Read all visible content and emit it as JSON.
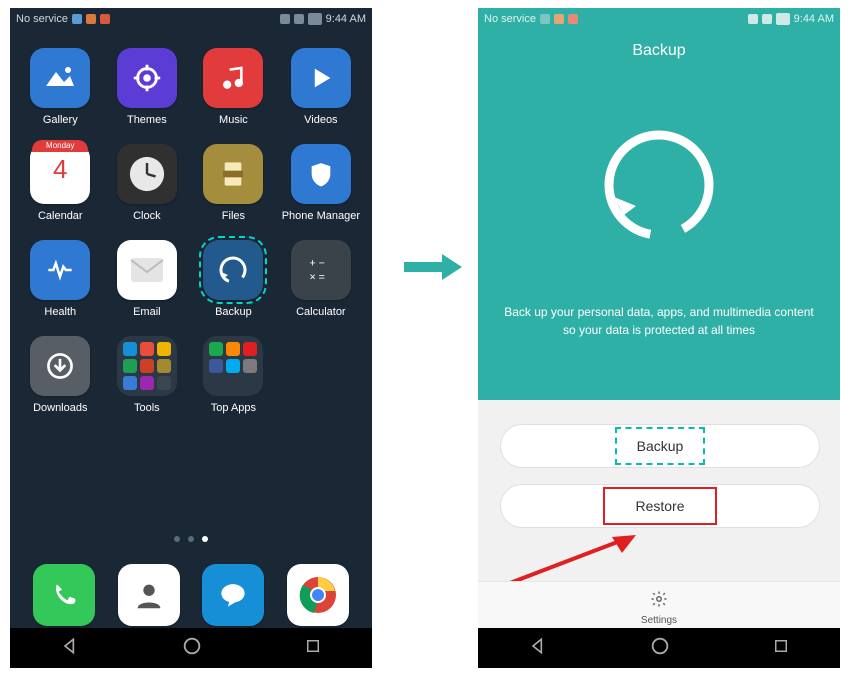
{
  "statusbar": {
    "network": "No service",
    "time": "9:44 AM"
  },
  "home": {
    "apps": [
      {
        "name": "gallery",
        "label": "Gallery",
        "bg": "#2f79d2",
        "glyph": "gallery"
      },
      {
        "name": "themes",
        "label": "Themes",
        "bg": "#5b3dd6",
        "glyph": "themes"
      },
      {
        "name": "music",
        "label": "Music",
        "bg": "#e23b3b",
        "glyph": "music"
      },
      {
        "name": "videos",
        "label": "Videos",
        "bg": "#2f79d2",
        "glyph": "play"
      },
      {
        "name": "calendar",
        "label": "Calendar",
        "bg": "#ffffff",
        "glyph": "calendar",
        "textcolor": "#e23b3b"
      },
      {
        "name": "clock",
        "label": "Clock",
        "bg": "#303030",
        "glyph": "clock"
      },
      {
        "name": "files",
        "label": "Files",
        "bg": "#a58d3e",
        "glyph": "files"
      },
      {
        "name": "phonemgr",
        "label": "Phone Manager",
        "bg": "#2f79d2",
        "glyph": "shield"
      },
      {
        "name": "health",
        "label": "Health",
        "bg": "#2f79d2",
        "glyph": "heart"
      },
      {
        "name": "email",
        "label": "Email",
        "bg": "#ffffff",
        "glyph": "mail",
        "textcolor": "#888"
      },
      {
        "name": "backup",
        "label": "Backup",
        "bg": "#235a8e",
        "glyph": "backup",
        "highlight": true
      },
      {
        "name": "calc",
        "label": "Calculator",
        "bg": "#3a424a",
        "glyph": "calc"
      },
      {
        "name": "downloads",
        "label": "Downloads",
        "bg": "#585e66",
        "glyph": "download"
      },
      {
        "name": "tools",
        "label": "Tools",
        "folder": true,
        "minis": [
          "#178fd6",
          "#e94d3c",
          "#f0b400",
          "#1da056",
          "#cc4125",
          "#a5892e",
          "#3a7bd5",
          "#9c27b0",
          "#3b474f"
        ]
      },
      {
        "name": "topapps",
        "label": "Top Apps",
        "folder": true,
        "minis": [
          "#1ba94c",
          "#ff8800",
          "#e02020",
          "#3b5998",
          "#00acee",
          "#7b7b7b"
        ]
      }
    ],
    "calendar": {
      "day_label": "Monday",
      "day_num": "4"
    },
    "page_indicator": {
      "count": 3,
      "active": 2
    },
    "dock": [
      {
        "name": "phone",
        "bg": "#34c759",
        "glyph": "phone"
      },
      {
        "name": "contacts",
        "bg": "#ffffff",
        "glyph": "contact",
        "textcolor": "#555"
      },
      {
        "name": "messages",
        "bg": "#178fd6",
        "glyph": "chat"
      },
      {
        "name": "chrome",
        "bg": "#ffffff",
        "glyph": "chrome"
      }
    ]
  },
  "backup_screen": {
    "title": "Backup",
    "description_l1": "Back up your personal data, apps, and multimedia content",
    "description_l2": "so your data is protected at all times",
    "backup_btn": "Backup",
    "restore_btn": "Restore",
    "settings": "Settings"
  }
}
